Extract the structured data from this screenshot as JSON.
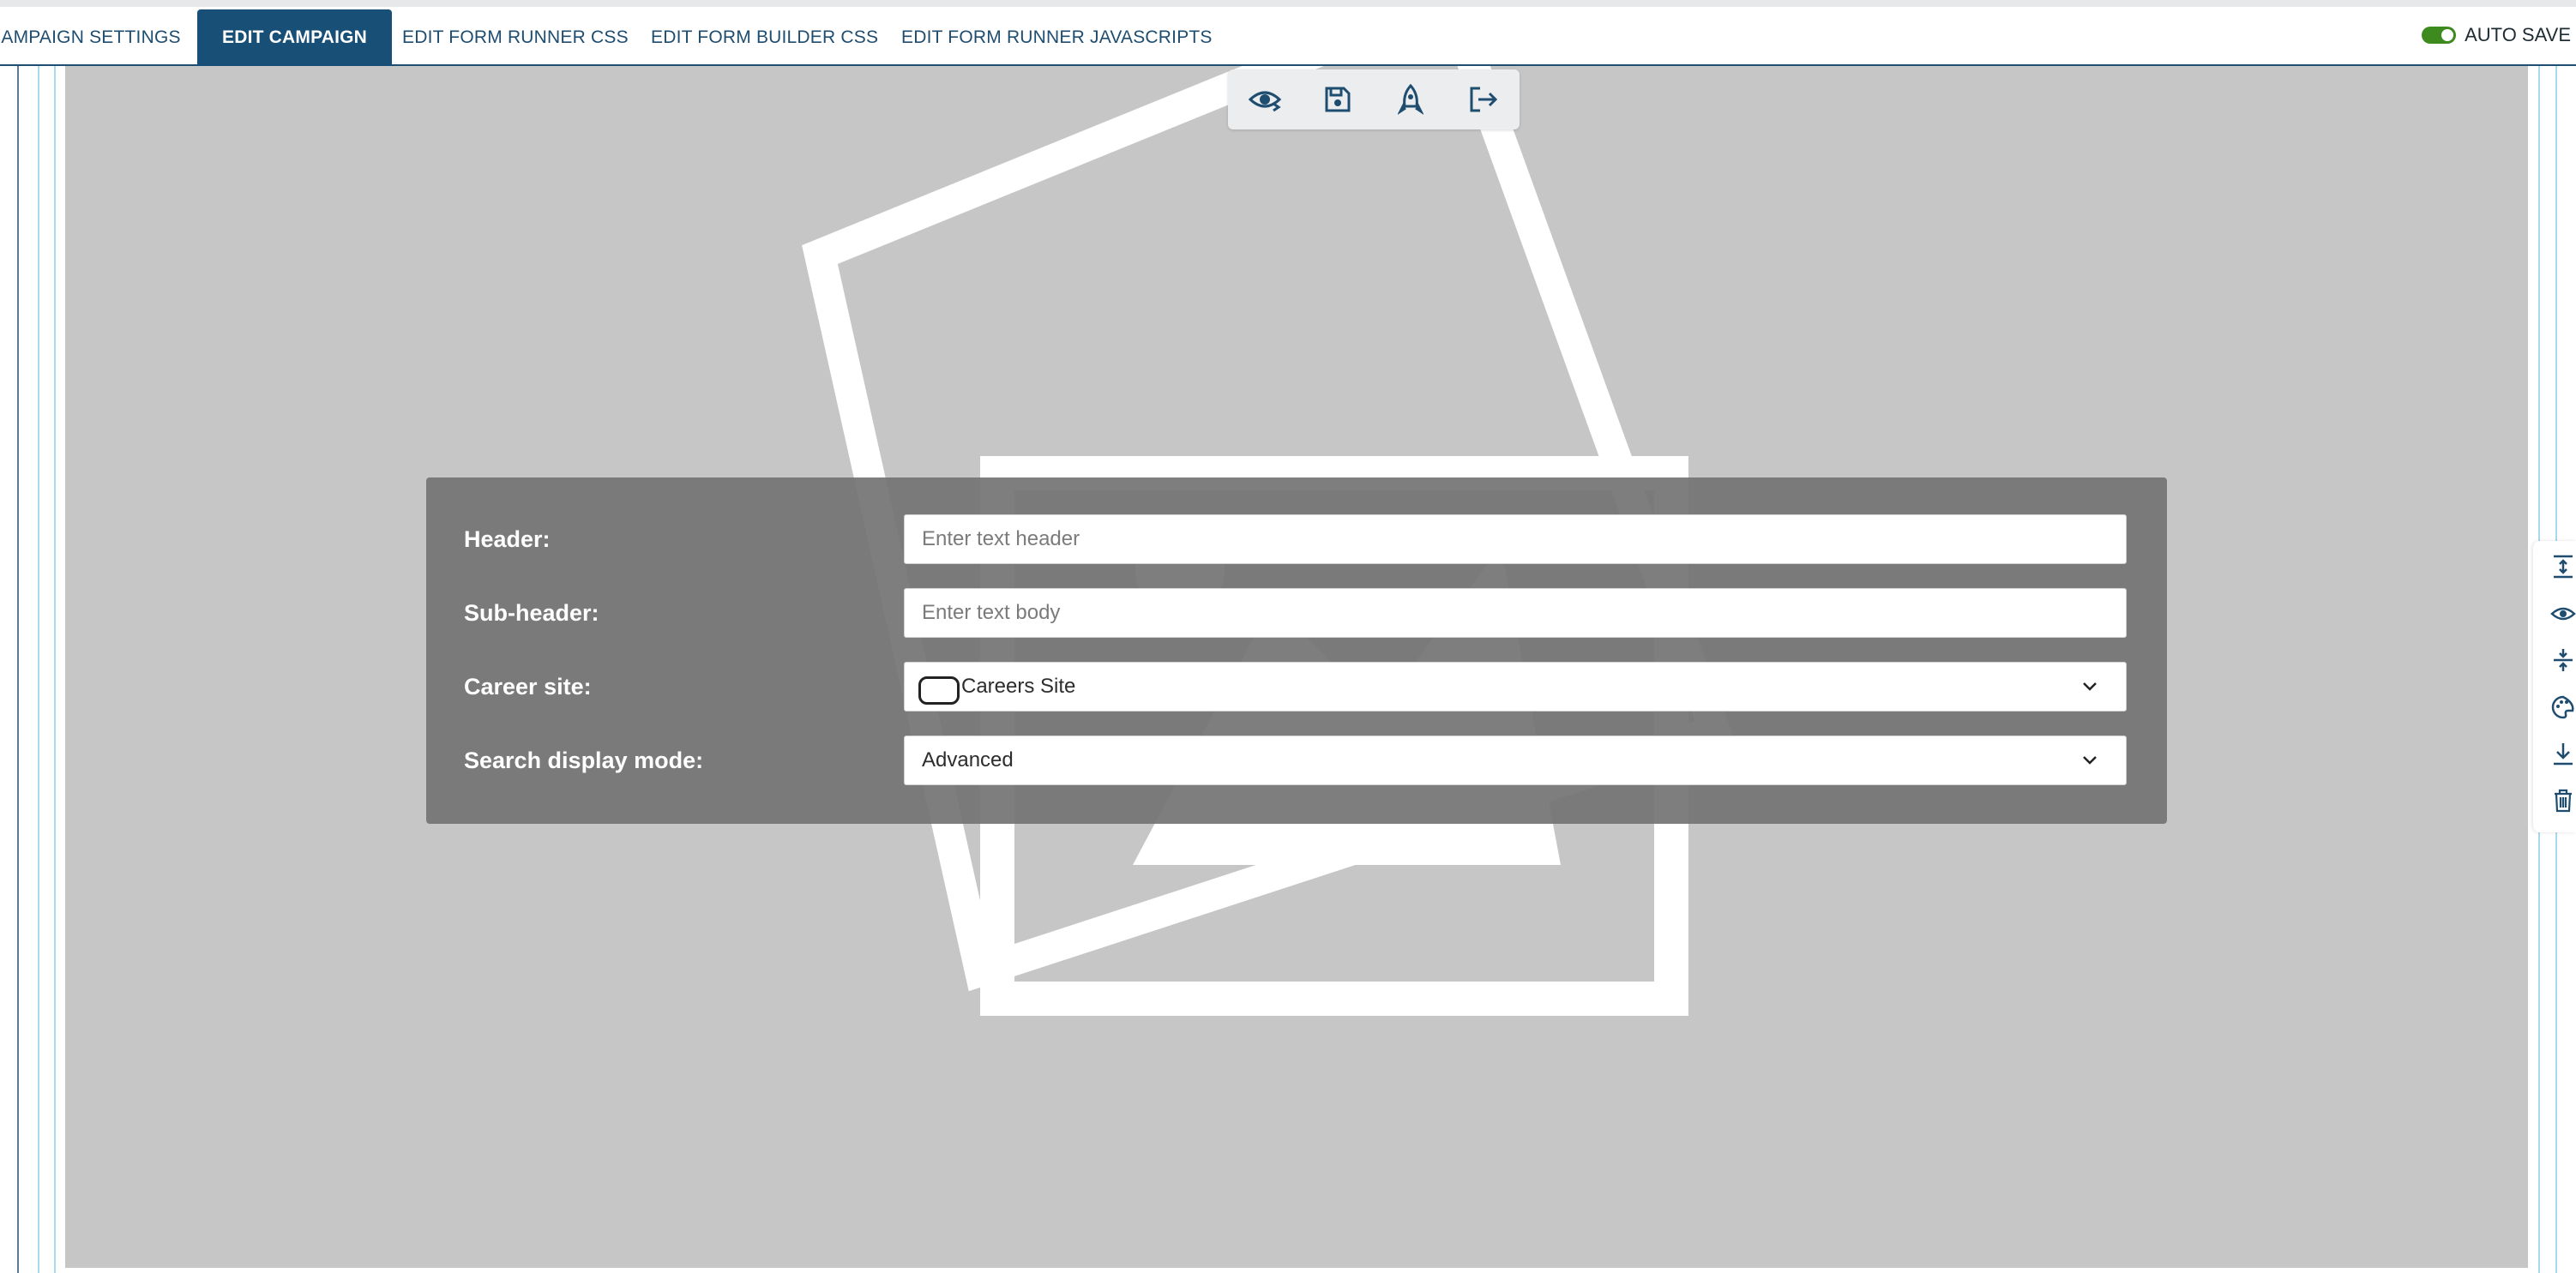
{
  "tabs": [
    {
      "label": "CAMPAIGN SETTINGS",
      "active": false
    },
    {
      "label": "EDIT CAMPAIGN",
      "active": true
    },
    {
      "label": "EDIT FORM RUNNER CSS",
      "active": false
    },
    {
      "label": "EDIT FORM BUILDER CSS",
      "active": false
    },
    {
      "label": "EDIT FORM RUNNER JAVASCRIPTS",
      "active": false
    }
  ],
  "autosave": {
    "label": "AUTO SAVE",
    "enabled": true
  },
  "toolbar": {
    "icons": [
      "preview-eye-icon",
      "save-floppy-icon",
      "publish-rocket-icon",
      "exit-icon"
    ]
  },
  "form": {
    "header": {
      "label": "Header:",
      "placeholder": "Enter text header",
      "value": ""
    },
    "subheader": {
      "label": "Sub-header:",
      "placeholder": "Enter text body",
      "value": ""
    },
    "career_site": {
      "label": "Career site:",
      "value": "Careers Site"
    },
    "search_display_mode": {
      "label": "Search display mode:",
      "value": "Advanced"
    }
  },
  "right_tools": {
    "icons": [
      "expand-vertical-icon",
      "visibility-eye-icon",
      "collapse-vertical-icon",
      "palette-icon",
      "download-icon",
      "trash-icon"
    ]
  },
  "colors": {
    "tab_active_bg": "#174f77",
    "tab_text": "#1f4d70",
    "toggle_on": "#3d8b1e",
    "canvas_bg": "#c6c6c6",
    "panel_bg": "#747474"
  }
}
